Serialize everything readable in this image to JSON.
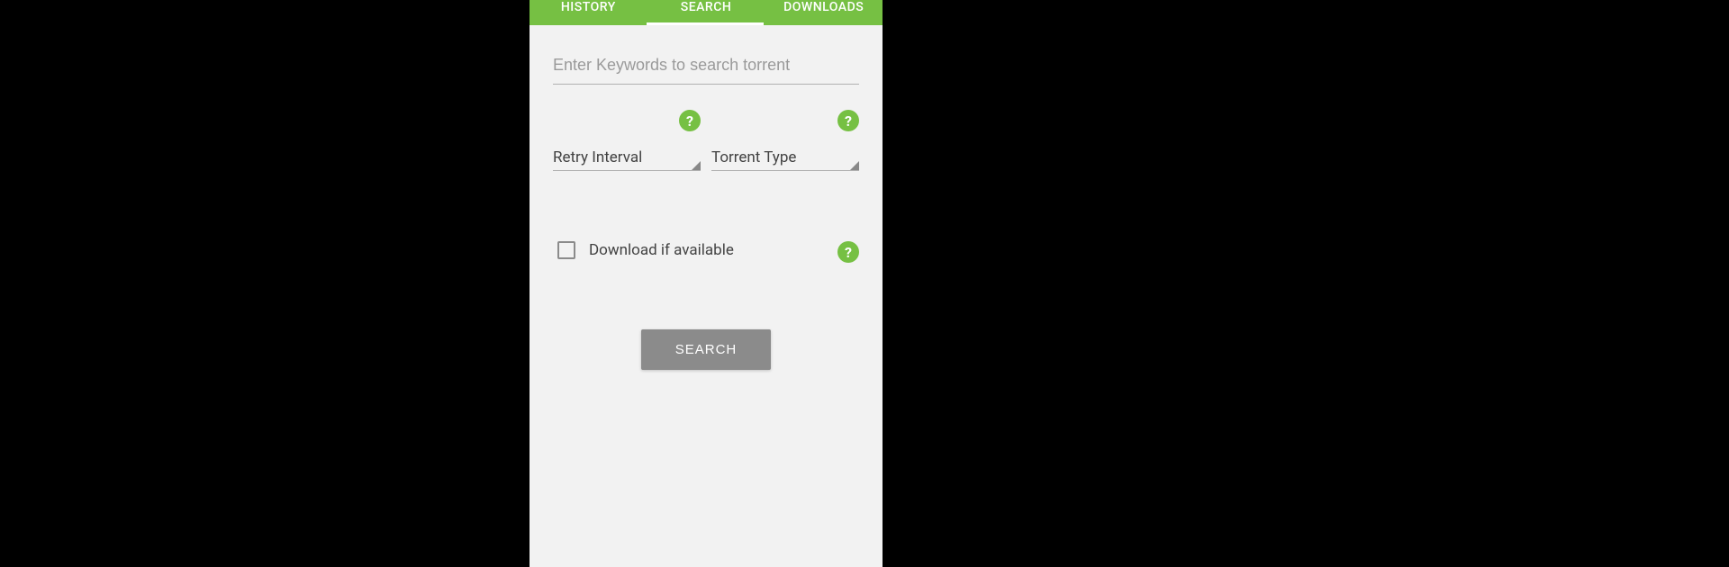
{
  "tabs": {
    "history": "HISTORY",
    "search": "SEARCH",
    "downloads": "DOWNLOADS"
  },
  "form": {
    "search_placeholder": "Enter Keywords to search torrent",
    "retry_interval_label": "Retry Interval",
    "torrent_type_label": "Torrent Type",
    "download_avail_label": "Download if available",
    "search_button": "SEARCH",
    "help_glyph": "?"
  }
}
